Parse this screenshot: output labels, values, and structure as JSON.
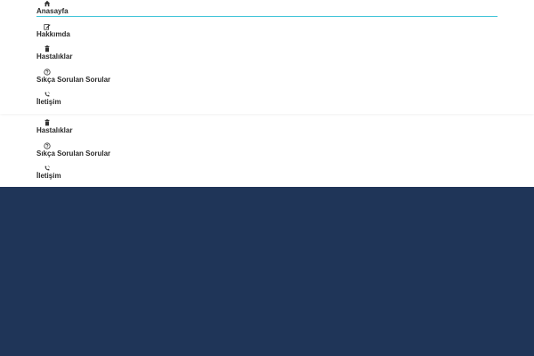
{
  "main_nav": {
    "items": [
      {
        "label": "Anasayfa",
        "icon": "home-icon",
        "active": true
      },
      {
        "label": "Hakkımda",
        "icon": "edit-icon"
      },
      {
        "label": "Hastalıklar",
        "icon": "trash-icon"
      },
      {
        "label": "Sıkça Sorulan Sorular",
        "icon": "question-circle-icon"
      },
      {
        "label": "İletişim",
        "icon": "phone-icon"
      }
    ]
  },
  "secondary_nav": {
    "items": [
      {
        "label": "Hastalıklar",
        "icon": "trash-icon"
      },
      {
        "label": "Sıkça Sorulan Sorular",
        "icon": "question-circle-icon"
      },
      {
        "label": "İletişim",
        "icon": "phone-icon"
      }
    ]
  },
  "colors": {
    "active_underline": "#42c5d9",
    "background_band": "#1f3558",
    "text": "#2b2b2b"
  }
}
